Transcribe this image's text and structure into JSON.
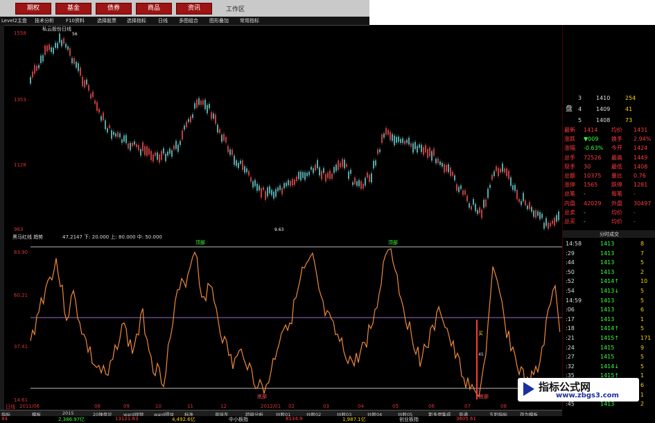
{
  "menu": {
    "buttons": [
      "期权",
      "基金",
      "债券",
      "商品",
      "资讯"
    ],
    "workarea": "工作区"
  },
  "toolbar": [
    "Level2主盘",
    "技术分析",
    "F10资料",
    "选择股票",
    "选择指标",
    "日线",
    "多图组合",
    "图形叠加",
    "常用指标"
  ],
  "price_chart": {
    "name_label": "私云股份日线",
    "axis_labels": [
      "1558",
      "1353",
      "1128",
      "963"
    ],
    "top_marker": "56",
    "bottom_marker": "9.63"
  },
  "osc_chart": {
    "indicator_label": "黑马红线  趋势",
    "params": "47.2147  下: 20.000  上: 80.000  中: 50.000",
    "axis_labels": [
      "83.90",
      "60.21",
      "37.41",
      "14.61"
    ],
    "top_tags": [
      "顶部",
      "顶部"
    ],
    "bottom_tags": [
      "底部",
      "底部"
    ],
    "buy_tag": "买",
    "buy_value": "45"
  },
  "date_axis": [
    "日线",
    "2011/06",
    "08",
    "09",
    "10",
    "11",
    "12",
    "2012/01",
    "02",
    "03",
    "04",
    "05",
    "06",
    "07",
    "08"
  ],
  "quote": {
    "level_rows": [
      {
        "no": "3",
        "price": "1410",
        "vol": "254"
      },
      {
        "no": "4",
        "price": "1409",
        "vol": "41"
      },
      {
        "no": "5",
        "price": "1408",
        "vol": "73"
      }
    ],
    "side_label": "盘",
    "fields": [
      {
        "k1": "最新",
        "v1": "1414",
        "k2": "均价",
        "v2": "1431"
      },
      {
        "k1": "涨跌",
        "v1": "▼009",
        "k2": "换手",
        "v2": "2.94%"
      },
      {
        "k1": "涨幅",
        "v1": "-0.63%",
        "k2": "今开",
        "v2": "1424"
      },
      {
        "k1": "总手",
        "v1": "72526",
        "k2": "最高",
        "v2": "1449"
      },
      {
        "k1": "现手",
        "v1": "30",
        "k2": "最低",
        "v2": "1408"
      },
      {
        "k1": "总额",
        "v1": "10375",
        "k2": "量比",
        "v2": "0.76"
      },
      {
        "k1": "涨停",
        "v1": "1565",
        "k2": "跌停",
        "v2": "1281"
      },
      {
        "k1": "总笔",
        "v1": "-",
        "k2": "每笔",
        "v2": "-"
      },
      {
        "k1": "内盘",
        "v1": "42029",
        "k2": "外盘",
        "v2": "30497"
      },
      {
        "k1": "总卖",
        "v1": "-",
        "k2": "均价",
        "v2": "-"
      },
      {
        "k1": "总买",
        "v1": "-",
        "k2": "均价",
        "v2": "-"
      }
    ],
    "tick_header": "分时成交",
    "ticks": [
      {
        "t": "14:58",
        "p": "1413",
        "v": "8"
      },
      {
        "t": ":29",
        "p": "1413",
        "v": "7"
      },
      {
        "t": ":44",
        "p": "1413",
        "v": "5"
      },
      {
        "t": ":50",
        "p": "1413",
        "v": "2"
      },
      {
        "t": ":52",
        "p": "1414↑",
        "v": "10"
      },
      {
        "t": ":54",
        "p": "1413↓",
        "v": "5"
      },
      {
        "t": "14:59",
        "p": "1413",
        "v": "5"
      },
      {
        "t": ":06",
        "p": "1413",
        "v": "6"
      },
      {
        "t": ":17",
        "p": "1413",
        "v": "1"
      },
      {
        "t": ":18",
        "p": "1414↑",
        "v": "5"
      },
      {
        "t": ":21",
        "p": "1415↑",
        "v": "171"
      },
      {
        "t": ":24",
        "p": "1415",
        "v": "9"
      },
      {
        "t": ":27",
        "p": "1415",
        "v": "5"
      },
      {
        "t": ":32",
        "p": "1414↓",
        "v": "5"
      },
      {
        "t": ":35",
        "p": "1415↑",
        "v": "1"
      },
      {
        "t": ":38",
        "p": "1413↓",
        "v": "6"
      },
      {
        "t": ":43",
        "p": "1413",
        "v": "1"
      },
      {
        "t": ":45",
        "p": "1413",
        "v": "2"
      }
    ]
  },
  "bottom_tabs": [
    "指标",
    "模板",
    "2015",
    "20操盘论",
    "ward视频",
    "ward得益",
    "标准",
    "直接东",
    "超级分析",
    "炒股01",
    "炒股02",
    "炒股03",
    "炒股04",
    "炒股05",
    "斯多伊集成",
    "普通",
    "五阳指标",
    "存为模板"
  ],
  "bottom_ticker": [
    {
      "text": "84",
      "color": "#ff3c3c"
    },
    {
      "text": "2,386.97亿",
      "color": "#3cff3c"
    },
    {
      "text": "13121.83",
      "color": "#ff3c3c"
    },
    {
      "text": "4,492.6亿",
      "color": "#ffd200"
    },
    {
      "text": "中小板指",
      "color": "#ddd"
    },
    {
      "text": "8134.9",
      "color": "#ff3c3c"
    },
    {
      "text": "1,987.1亿",
      "color": "#ffd200"
    },
    {
      "text": "创业板指",
      "color": "#ddd"
    },
    {
      "text": "3605.61",
      "color": "#ff3c3c"
    }
  ],
  "watermark": {
    "title": "指标公式网",
    "url": "www.zbgs3.com"
  },
  "colors": {
    "up": "#ff3c3c",
    "down": "#3cff3c",
    "osc_line": "#f08a3a",
    "price_up": "#c04040",
    "price_down": "#5aa8a8"
  }
}
